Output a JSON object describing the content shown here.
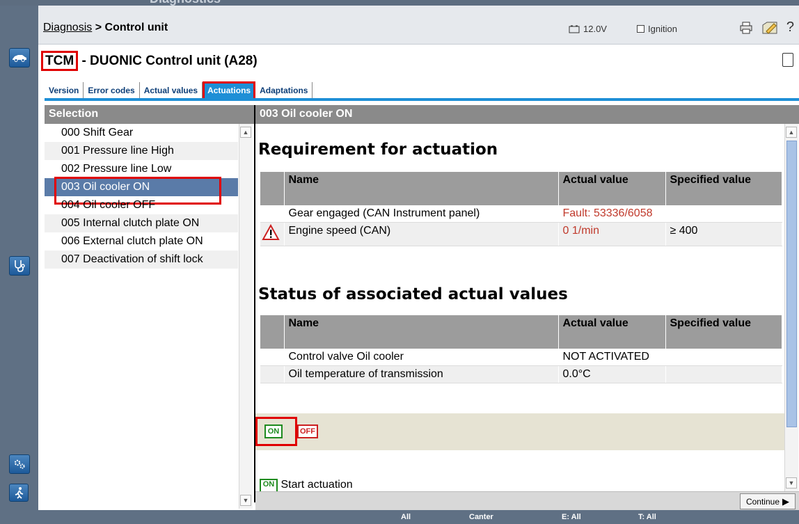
{
  "window": {
    "ghost_title": "Diagnostics"
  },
  "breadcrumb": {
    "link": "Diagnosis",
    "separator": ">",
    "current": "Control unit"
  },
  "status": {
    "voltage": "12.0V",
    "ignition_label": "Ignition"
  },
  "toolbar_icons": [
    "printer-icon",
    "edit-icon",
    "help-icon"
  ],
  "help_label": "?",
  "header": {
    "tcm": "TCM",
    "title": "- DUONIC Control unit (A28)"
  },
  "tabs": [
    {
      "label": "Version"
    },
    {
      "label": "Error codes"
    },
    {
      "label": "Actual values"
    },
    {
      "label": "Actuations"
    },
    {
      "label": "Adaptations"
    }
  ],
  "selection": {
    "header": "Selection",
    "items": [
      "000 Shift Gear",
      "001 Pressure line High",
      "002 Pressure line Low",
      "003 Oil cooler ON",
      "004 Oil cooler OFF",
      "005 Internal clutch plate ON",
      "006 External clutch plate ON",
      "007 Deactivation of shift lock"
    ],
    "selected_index": 3
  },
  "detail": {
    "header": "003 Oil cooler ON",
    "requirement": {
      "title": "Requirement for actuation",
      "columns": [
        "Name",
        "Actual value",
        "Specified value"
      ],
      "rows": [
        {
          "name": "Gear engaged (CAN Instrument panel)",
          "actual": "Fault: 53336/6058",
          "specified": "",
          "warning": false
        },
        {
          "name": "Engine speed (CAN)",
          "actual": "0 1/min",
          "specified": "≥ 400",
          "warning": true
        }
      ]
    },
    "status_values": {
      "title": "Status of associated actual values",
      "columns": [
        "Name",
        "Actual value",
        "Specified value"
      ],
      "rows": [
        {
          "name": "Control valve Oil cooler",
          "actual": "NOT ACTIVATED",
          "specified": ""
        },
        {
          "name": "Oil temperature of transmission",
          "actual": "0.0°C",
          "specified": ""
        }
      ]
    },
    "buttons": {
      "on": "ON",
      "off": "OFF"
    },
    "legend": {
      "badge": "ON",
      "text": "Start actuation"
    }
  },
  "continue_label": "Continue",
  "statusbar": {
    "all": "All",
    "model": "Canter",
    "e": "E: All",
    "t": "T: All"
  }
}
